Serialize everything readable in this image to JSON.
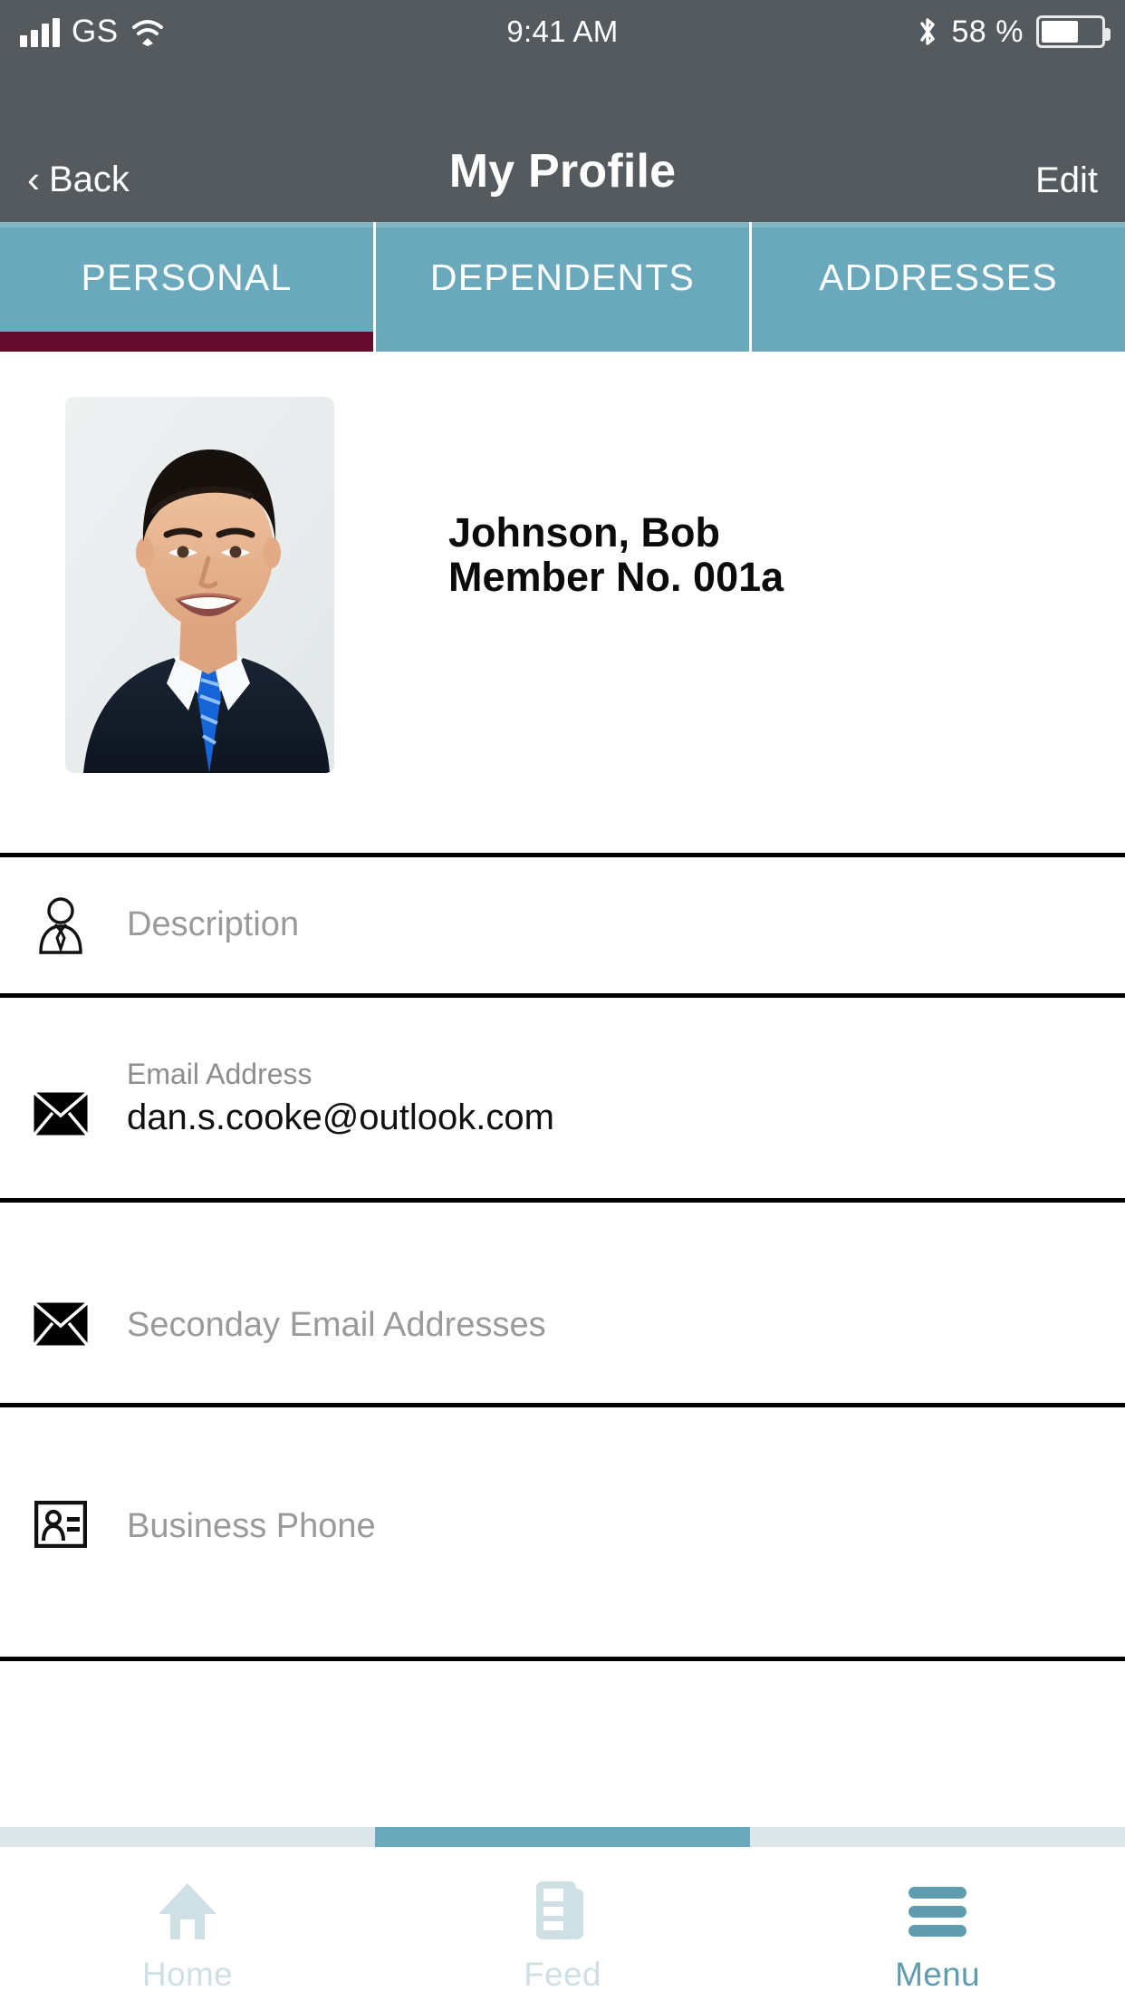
{
  "status_bar": {
    "carrier": "GS",
    "time": "9:41 AM",
    "battery_percent": "58 %",
    "icons": [
      "signal-bars-icon",
      "wifi-icon",
      "bluetooth-icon",
      "battery-icon"
    ]
  },
  "nav_bar": {
    "back_chevron": "‹",
    "back_label": "Back",
    "title": "My Profile",
    "edit_label": "Edit"
  },
  "tabs": {
    "items": [
      {
        "label": "PERSONAL",
        "active": true
      },
      {
        "label": "DEPENDENTS",
        "active": false
      },
      {
        "label": "ADDRESSES",
        "active": false
      }
    ],
    "active_indicator_color": "#640a2b",
    "background_color": "#69a9bb"
  },
  "profile": {
    "photo_alt": "profile-photo",
    "name": "Johnson, Bob",
    "member_no": "Member No. 001a"
  },
  "fields": [
    {
      "icon": "person-tie-icon",
      "label": "",
      "placeholder": "Description",
      "value": ""
    },
    {
      "icon": "envelope-icon",
      "label": "Email Address",
      "placeholder": "",
      "value": "dan.s.cooke@outlook.com"
    },
    {
      "icon": "envelope-icon",
      "label": "",
      "placeholder": "Seconday Email Addresses",
      "value": ""
    },
    {
      "icon": "contact-card-icon",
      "label": "",
      "placeholder": "Business Phone",
      "value": ""
    }
  ],
  "bottom_bar": {
    "items": [
      {
        "label": "Home",
        "icon": "home-icon",
        "active": false
      },
      {
        "label": "Feed",
        "icon": "feed-icon",
        "active": false
      },
      {
        "label": "Menu",
        "icon": "hamburger-icon",
        "active": true
      }
    ],
    "accent_color": "#69a9bb",
    "inactive_color": "#cfe0e5"
  }
}
